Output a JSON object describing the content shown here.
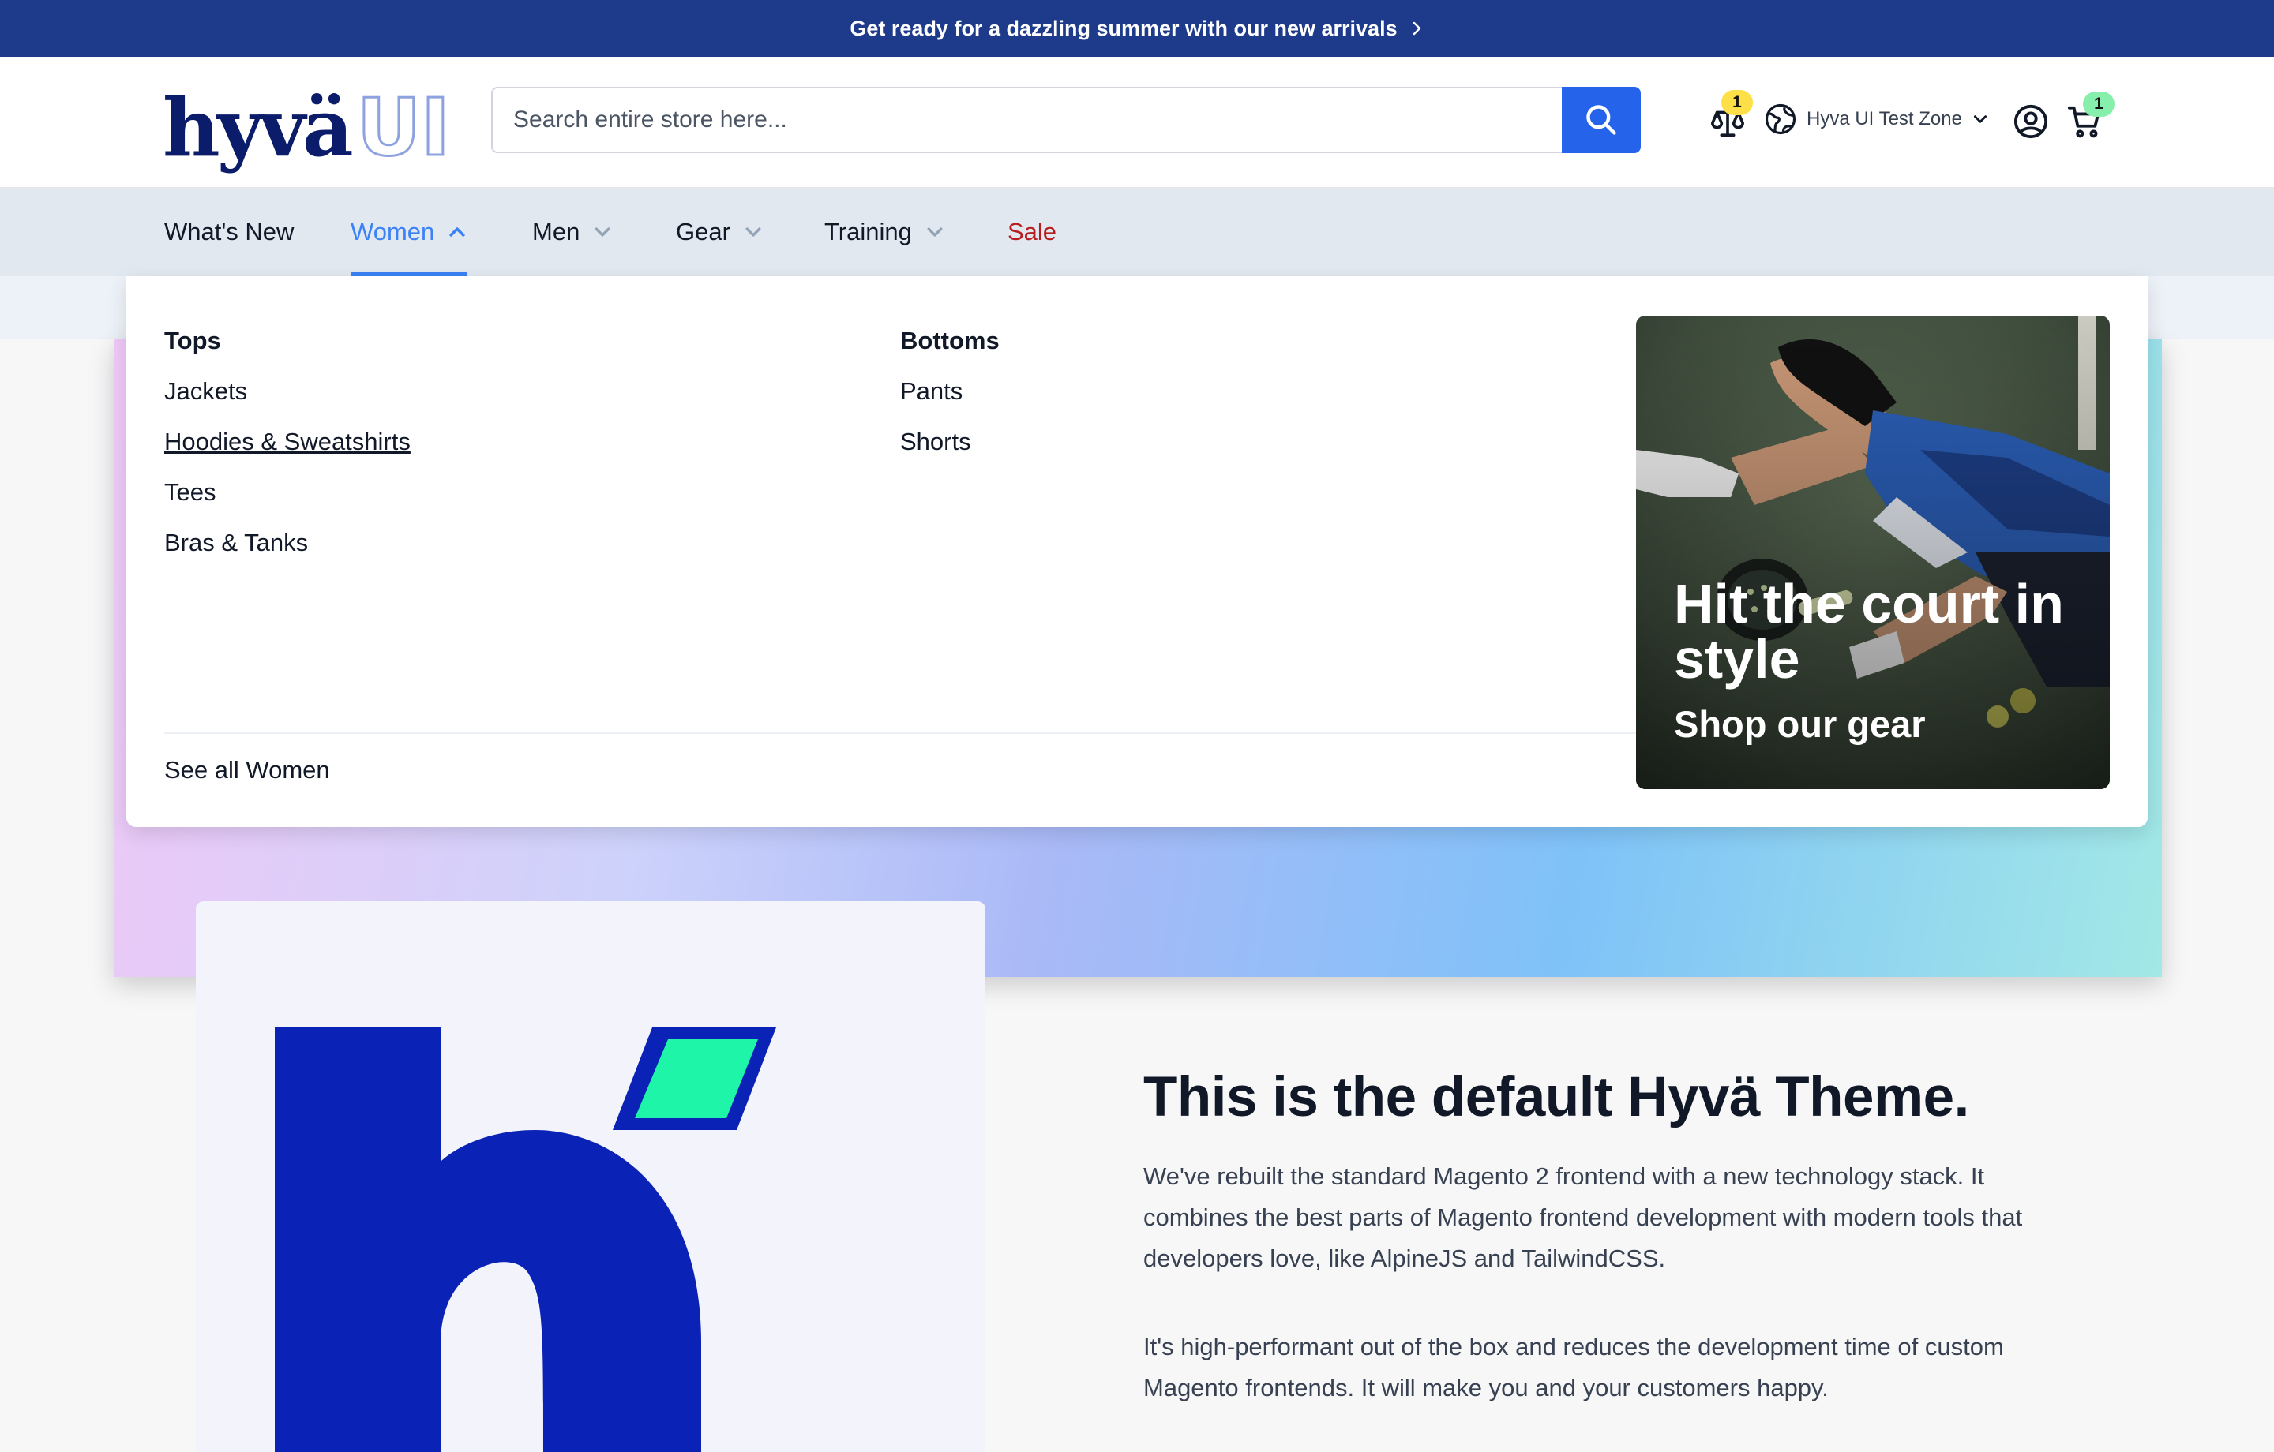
{
  "announcement": {
    "text": "Get ready for a dazzling summer with our new arrivals"
  },
  "header": {
    "logo_main": "hyvä",
    "logo_sub": "UI",
    "search_placeholder": "Search entire store here...",
    "compare_count": "1",
    "store_name": "Hyva UI Test Zone",
    "cart_count": "1"
  },
  "nav": {
    "items": [
      {
        "label": "What's New"
      },
      {
        "label": "Women"
      },
      {
        "label": "Men"
      },
      {
        "label": "Gear"
      },
      {
        "label": "Training"
      },
      {
        "label": "Sale"
      }
    ]
  },
  "dropdown": {
    "columns": [
      {
        "title": "Tops",
        "links": [
          "Jackets",
          "Hoodies & Sweatshirts",
          "Tees",
          "Bras & Tanks"
        ]
      },
      {
        "title": "Bottoms",
        "links": [
          "Pants",
          "Shorts"
        ]
      }
    ],
    "see_all": "See all Women",
    "promo": {
      "title": "Hit the court in style",
      "subtitle": "Shop our gear"
    }
  },
  "content": {
    "heading": "This is the default Hyvä Theme.",
    "paragraphs": [
      "We've rebuilt the standard Magento 2 frontend with a new technology stack. It combines the best parts of Magento frontend development with modern tools that developers love, like AlpineJS and TailwindCSS.",
      "It's high-performant out of the box and reduces the development time of custom Magento frontends. It will make you and your customers happy."
    ]
  },
  "colors": {
    "announcement_bg": "#1e3a8a",
    "accent": "#2563eb",
    "nav_active": "#3b82f6",
    "sale": "#b91c1c",
    "compare_badge": "#fde047",
    "cart_badge": "#86efac",
    "brand_blue": "#0a22b5",
    "brand_green": "#1ef5a8"
  }
}
